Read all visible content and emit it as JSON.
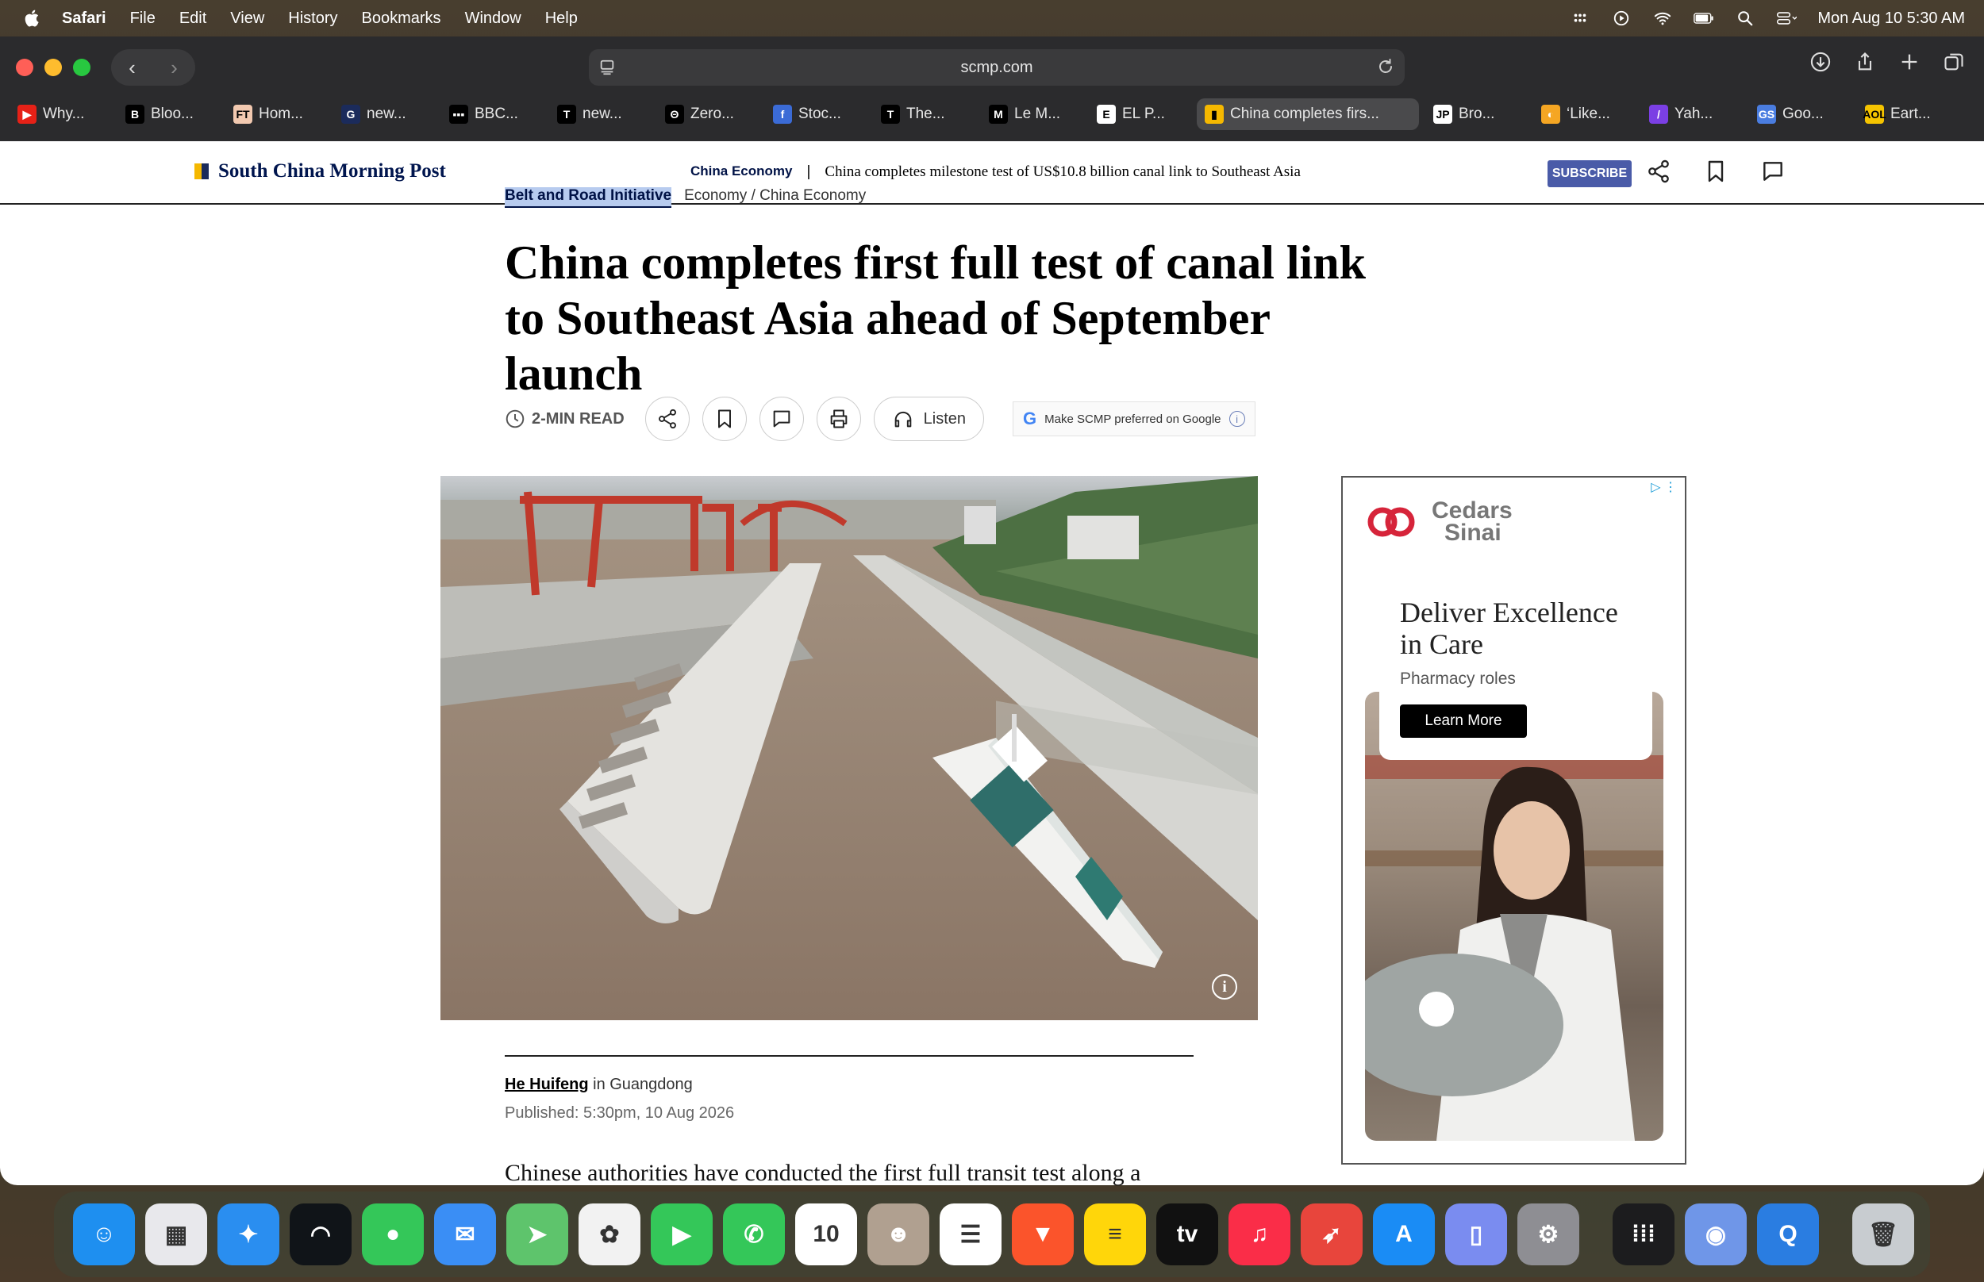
{
  "menubar": {
    "app": "Safari",
    "items": [
      "File",
      "Edit",
      "View",
      "History",
      "Bookmarks",
      "Window",
      "Help"
    ],
    "clock": "Mon Aug 10  5:30 AM"
  },
  "browser": {
    "url": "scmp.com",
    "tabs": [
      {
        "label": "Why...",
        "fav": "▶",
        "color": "#e62117"
      },
      {
        "label": "Bloo...",
        "fav": "B",
        "color": "#000000"
      },
      {
        "label": "Hom...",
        "fav": "FT",
        "color": "#f2c9b0"
      },
      {
        "label": "new...",
        "fav": "G",
        "color": "#1b2b5b"
      },
      {
        "label": "BBC...",
        "fav": "▪▪▪",
        "color": "#000000"
      },
      {
        "label": "new...",
        "fav": "T",
        "color": "#000000"
      },
      {
        "label": "Zero...",
        "fav": "Θ",
        "color": "#000000"
      },
      {
        "label": "Stoc...",
        "fav": "f",
        "color": "#3b6bd6"
      },
      {
        "label": "The...",
        "fav": "T",
        "color": "#000000"
      },
      {
        "label": "Le M...",
        "fav": "M",
        "color": "#000000"
      },
      {
        "label": "EL P...",
        "fav": "E",
        "color": "#ffffff"
      },
      {
        "label": "China completes firs...",
        "fav": "▮",
        "color": "#f5b800",
        "active": true
      },
      {
        "label": "Bro...",
        "fav": "JP",
        "color": "#ffffff"
      },
      {
        "label": "‘Like...",
        "fav": "◐",
        "color": "#f5a623"
      },
      {
        "label": "Yah...",
        "fav": "/",
        "color": "#7b3fe4"
      },
      {
        "label": "Goo...",
        "fav": "GS",
        "color": "#4a7de0"
      },
      {
        "label": "Eart...",
        "fav": "AOL",
        "color": "#f5c400"
      }
    ]
  },
  "site": {
    "name": "South China Morning Post",
    "section": "China Economy",
    "header_title": "China completes milestone test of US$10.8 billion canal link to Southeast Asia",
    "subscribe": "SUBSCRIBE"
  },
  "article": {
    "topic": "Belt and Road Initiative",
    "breadcrumb": "Economy / China Economy",
    "headline": "China completes first full test of canal link to Southeast Asia ahead of September launch",
    "read_time": "2-MIN READ",
    "listen": "Listen",
    "google_pref": "Make SCMP preferred on Google",
    "author": "He Huifeng",
    "location": " in Guangdong",
    "published": "Published: 5:30pm, 10 Aug 2026",
    "body_start": "Chinese authorities have conducted the first full transit test along a"
  },
  "ad": {
    "brand_line1": "Cedars",
    "brand_line2": "Sinai",
    "headline": "Deliver Excellence in Care",
    "sub": "Pharmacy roles",
    "cta": "Learn More"
  },
  "dock": {
    "apps": [
      {
        "name": "finder",
        "color": "#1e8ff0",
        "glyph": "☺"
      },
      {
        "name": "launchpad",
        "color": "#e8e8ec",
        "glyph": "▦"
      },
      {
        "name": "safari",
        "color": "#2a8ef0",
        "glyph": "✦"
      },
      {
        "name": "wavelink",
        "color": "#101418",
        "glyph": "◠"
      },
      {
        "name": "messages",
        "color": "#34c759",
        "glyph": "●"
      },
      {
        "name": "mail",
        "color": "#3a8ef5",
        "glyph": "✉"
      },
      {
        "name": "maps",
        "color": "#5ec46c",
        "glyph": "➤"
      },
      {
        "name": "photos",
        "color": "#f2f2f2",
        "glyph": "✿"
      },
      {
        "name": "facetime",
        "color": "#34c759",
        "glyph": "▶"
      },
      {
        "name": "phone",
        "color": "#34c759",
        "glyph": "✆"
      },
      {
        "name": "calendar",
        "color": "#ffffff",
        "glyph": "10"
      },
      {
        "name": "contacts",
        "color": "#b0a090",
        "glyph": "☻"
      },
      {
        "name": "reminders",
        "color": "#ffffff",
        "glyph": "☰"
      },
      {
        "name": "brave",
        "color": "#fb542b",
        "glyph": "▼"
      },
      {
        "name": "notes",
        "color": "#ffd60a",
        "glyph": "≡"
      },
      {
        "name": "tv",
        "color": "#111111",
        "glyph": "tv"
      },
      {
        "name": "music",
        "color": "#fa2d48",
        "glyph": "♫"
      },
      {
        "name": "rocket",
        "color": "#e8453c",
        "glyph": "➶"
      },
      {
        "name": "app-store",
        "color": "#1a8cf5",
        "glyph": "A"
      },
      {
        "name": "iphone-mirroring",
        "color": "#7a8cf0",
        "glyph": "▯"
      },
      {
        "name": "system-settings",
        "color": "#8e8e93",
        "glyph": "⚙"
      },
      {
        "name": "apps-grid",
        "color": "#1c1c1e",
        "glyph": "⁞⁞⁞"
      },
      {
        "name": "preview",
        "color": "#6f96e8",
        "glyph": "◉"
      },
      {
        "name": "quick-search",
        "color": "#2a7de1",
        "glyph": "Q"
      },
      {
        "name": "trash",
        "color": "#c8ccd0",
        "glyph": "🗑"
      }
    ]
  }
}
